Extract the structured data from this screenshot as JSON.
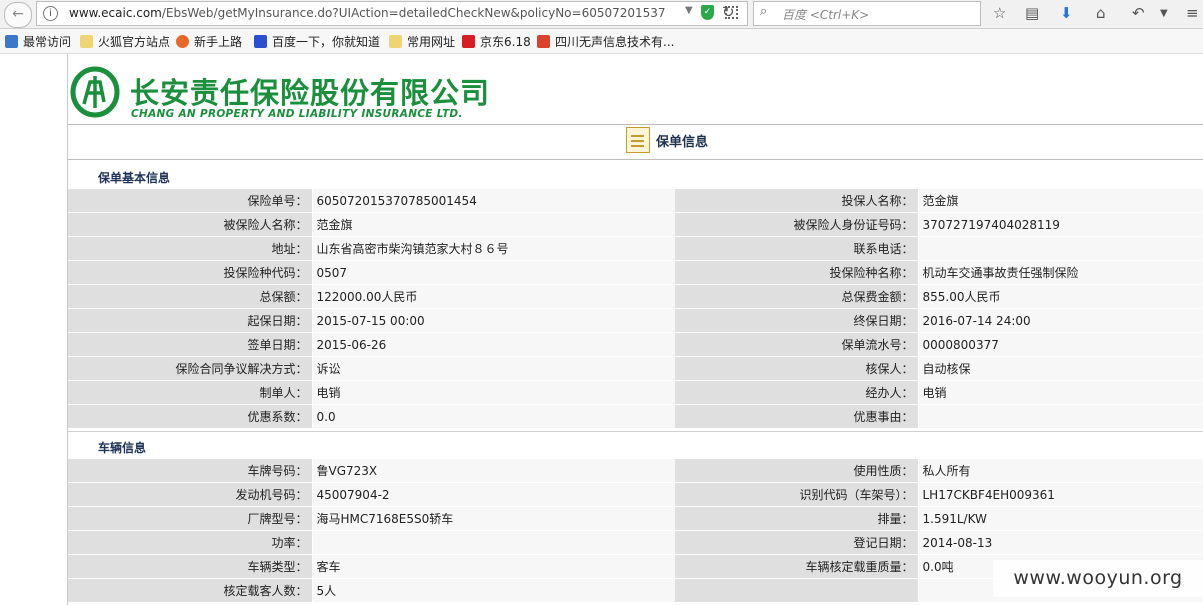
{
  "browser": {
    "url_domain": "www.ecaic.com",
    "url_rest": "/EbsWeb/getMyInsurance.do?UIAction=detailedCheckNew&policyNo=60507201537",
    "search_placeholder": "百度 <Ctrl+K>"
  },
  "bookmarks": [
    "最常访问",
    "火狐官方站点",
    "新手上路",
    "百度一下，你就知道",
    "常用网址",
    "京东6.18",
    "四川无声信息技术有..."
  ],
  "company": {
    "name_zh": "长安责任保险股份有限公司",
    "name_en": "CHANG AN PROPERTY AND LIABILITY INSURANCE LTD."
  },
  "page_title": "保单信息",
  "policy_section": {
    "title": "保单基本信息",
    "rows": [
      [
        "保险单号：",
        "605072015370785001454",
        "投保人名称：",
        "范金旗"
      ],
      [
        "被保险人名称：",
        "范金旗",
        "被保险人身份证号码：",
        "370727197404028119"
      ],
      [
        "地址：",
        "山东省高密市柴沟镇范家大村８６号",
        "联系电话：",
        ""
      ],
      [
        "投保险种代码：",
        "0507",
        "投保险种名称：",
        "机动车交通事故责任强制保险"
      ],
      [
        "总保额：",
        "122000.00人民币",
        "总保费金额：",
        "855.00人民币"
      ],
      [
        "起保日期：",
        "2015-07-15  00:00",
        "终保日期：",
        "2016-07-14  24:00"
      ],
      [
        "签单日期：",
        "2015-06-26",
        "保单流水号：",
        "0000800377"
      ],
      [
        "保险合同争议解决方式：",
        "诉讼",
        "核保人：",
        "自动核保"
      ],
      [
        "制单人：",
        "电销",
        "经办人：",
        "电销"
      ],
      [
        "优惠系数：",
        "0.0",
        "优惠事由：",
        ""
      ]
    ]
  },
  "vehicle_section": {
    "title": "车辆信息",
    "rows": [
      [
        "车牌号码：",
        "鲁VG723X",
        "使用性质：",
        "私人所有"
      ],
      [
        "发动机号码：",
        "45007904-2",
        "识别代码（车架号）：",
        "LH17CKBF4EH009361"
      ],
      [
        "厂牌型号：",
        "海马HMC7168E5S0轿车",
        "排量：",
        "1.591L/KW"
      ],
      [
        "功率：",
        "",
        "登记日期：",
        "2014-08-13"
      ],
      [
        "车辆类型：",
        "客车",
        "车辆核定载重质量：",
        "0.0吨"
      ],
      [
        "核定载客人数：",
        "5人",
        "",
        ""
      ]
    ]
  },
  "watermark": "www.wooyun.org",
  "colors": {
    "brand_green": "#1a8f3c",
    "label_bg": "#dfdfdf",
    "value_bg": "#f7f7f7",
    "section_title": "#1e3459"
  }
}
